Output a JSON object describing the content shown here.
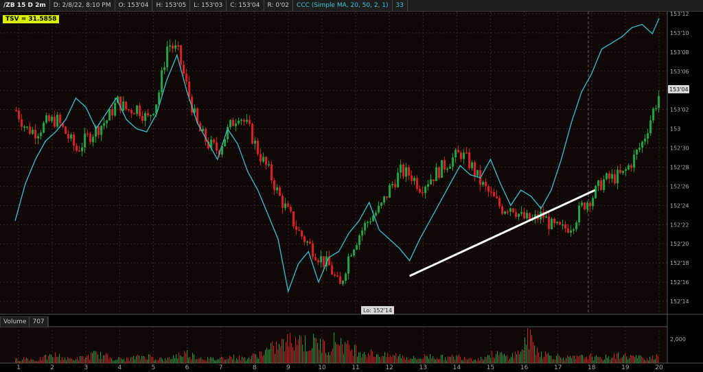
{
  "header": {
    "symbol": "/ZB 15 D 2m",
    "date": "D: 2/8/22, 8:10 PM",
    "open": "O: 153'04",
    "high": "H: 153'05",
    "low": "L: 153'03",
    "close": "C: 153'04",
    "range": "R: 0'02",
    "study": "CCC (Simple MA, 20, 50, 2, 1)",
    "study_value": "33"
  },
  "indicator_badge": "TSV = 31.5858",
  "volume_panel": {
    "label": "Volume",
    "value": "707",
    "tick": "2,000"
  },
  "low_marker": "Lo: 152'14",
  "current_price": "153'04",
  "colors": {
    "up": "#1fa83a",
    "down": "#e02020",
    "ccc": "#3ab7c8",
    "trendline": "#ffffff",
    "grid": "#3a2828",
    "background": "#000000"
  },
  "chart_data": {
    "type": "line",
    "y_ticks": [
      "153'12",
      "153'10",
      "153'08",
      "153'06",
      "153'04",
      "153'02",
      "153",
      "152'30",
      "152'28",
      "152'26",
      "152'24",
      "152'22",
      "152'20",
      "152'18",
      "152'16",
      "152'14"
    ],
    "x_ticks": [
      "1",
      "2",
      "3",
      "4",
      "5",
      "6",
      "7",
      "8",
      "9",
      "10",
      "11",
      "12",
      "13",
      "14",
      "15",
      "16",
      "17",
      "18",
      "19",
      "20"
    ],
    "ylim": [
      152.4375,
      153.375
    ],
    "price_series": {
      "name": "/ZB 15 D 2m",
      "x": [
        0.9,
        1.2,
        1.5,
        1.8,
        2.1,
        2.4,
        2.7,
        3.0,
        3.3,
        3.6,
        3.9,
        4.2,
        4.5,
        4.8,
        5.1,
        5.4,
        5.7,
        6.0,
        6.3,
        6.6,
        6.9,
        7.2,
        7.5,
        7.8,
        8.1,
        8.4,
        8.7,
        9.0,
        9.3,
        9.6,
        9.9,
        10.2,
        10.5,
        10.8,
        11.1,
        11.4,
        11.7,
        12.0,
        12.3,
        12.6,
        12.9,
        13.2,
        13.5,
        13.8,
        14.1,
        14.4,
        14.7,
        15.0,
        15.3,
        15.6,
        15.9,
        16.2,
        16.5,
        16.8,
        17.1,
        17.4,
        17.7,
        18.0,
        18.3,
        18.6,
        18.9,
        19.2,
        19.5,
        19.8,
        20.0
      ],
      "y": [
        153.06,
        153.0,
        152.99,
        153.02,
        153.03,
        152.98,
        152.93,
        152.97,
        153.0,
        153.03,
        153.09,
        153.06,
        153.07,
        153.03,
        153.1,
        153.28,
        153.25,
        153.12,
        153.0,
        152.95,
        152.93,
        153.0,
        153.05,
        153.0,
        152.92,
        152.86,
        152.78,
        152.72,
        152.66,
        152.62,
        152.58,
        152.55,
        152.48,
        152.6,
        152.66,
        152.71,
        152.74,
        152.81,
        152.86,
        152.85,
        152.81,
        152.84,
        152.87,
        152.9,
        152.92,
        152.88,
        152.82,
        152.78,
        152.74,
        152.75,
        152.71,
        152.7,
        152.72,
        152.68,
        152.67,
        152.69,
        152.75,
        152.78,
        152.83,
        152.84,
        152.85,
        152.9,
        152.96,
        153.06,
        153.12
      ]
    },
    "series": [
      {
        "name": "CCC (Simple MA, 20, 50, 2, 1)",
        "x": [
          0.9,
          1.2,
          1.5,
          1.8,
          2.1,
          2.4,
          2.7,
          3.0,
          3.3,
          3.6,
          3.9,
          4.2,
          4.5,
          4.8,
          5.1,
          5.4,
          5.7,
          6.0,
          6.3,
          6.6,
          6.9,
          7.2,
          7.5,
          7.8,
          8.1,
          8.4,
          8.7,
          9.0,
          9.3,
          9.6,
          9.9,
          10.2,
          10.5,
          10.8,
          11.1,
          11.4,
          11.7,
          12.0,
          12.3,
          12.6,
          12.9,
          13.2,
          13.5,
          13.8,
          14.1,
          14.4,
          14.7,
          15.0,
          15.3,
          15.6,
          15.9,
          16.2,
          16.5,
          16.8,
          17.1,
          17.4,
          17.7,
          18.0,
          18.3,
          18.6,
          18.9,
          19.2,
          19.5,
          19.8,
          20.0
        ],
        "y": [
          152.7,
          152.82,
          152.9,
          152.96,
          152.99,
          153.03,
          153.1,
          153.07,
          153.0,
          153.05,
          153.1,
          153.03,
          153.0,
          152.99,
          153.05,
          153.16,
          153.24,
          153.12,
          153.02,
          152.96,
          152.9,
          153.0,
          152.95,
          152.86,
          152.8,
          152.72,
          152.64,
          152.47,
          152.56,
          152.6,
          152.5,
          152.58,
          152.6,
          152.66,
          152.7,
          152.76,
          152.67,
          152.64,
          152.61,
          152.57,
          152.64,
          152.7,
          152.76,
          152.82,
          152.88,
          152.85,
          152.84,
          152.9,
          152.82,
          152.75,
          152.8,
          152.78,
          152.74,
          152.8,
          152.9,
          153.02,
          153.12,
          153.18,
          153.26,
          153.28,
          153.3,
          153.33,
          153.34,
          153.31,
          153.36
        ]
      }
    ],
    "volume_series": {
      "name": "Volume",
      "ylim": [
        0,
        2800
      ],
      "x_range": [
        0.9,
        20.0
      ],
      "values": [
        300,
        450,
        250,
        500,
        700,
        400,
        350,
        550,
        800,
        600,
        400,
        350,
        500,
        650,
        450,
        300,
        700,
        900,
        550,
        400,
        350,
        600,
        500,
        400,
        750,
        1100,
        1500,
        1800,
        2400,
        1600,
        1900,
        1300,
        2200,
        1400,
        1200,
        900,
        800,
        600,
        700,
        500,
        400,
        650,
        550,
        450,
        600,
        500,
        350,
        700,
        800,
        550,
        900,
        2300,
        1000,
        700,
        600,
        450,
        500,
        650,
        400,
        550,
        700,
        600,
        500,
        450,
        800
      ]
    },
    "annotation_trendline": {
      "x": [
        12.6,
        18.1
      ],
      "y": [
        152.52,
        152.8
      ]
    },
    "xlabel": "",
    "ylabel": ""
  }
}
